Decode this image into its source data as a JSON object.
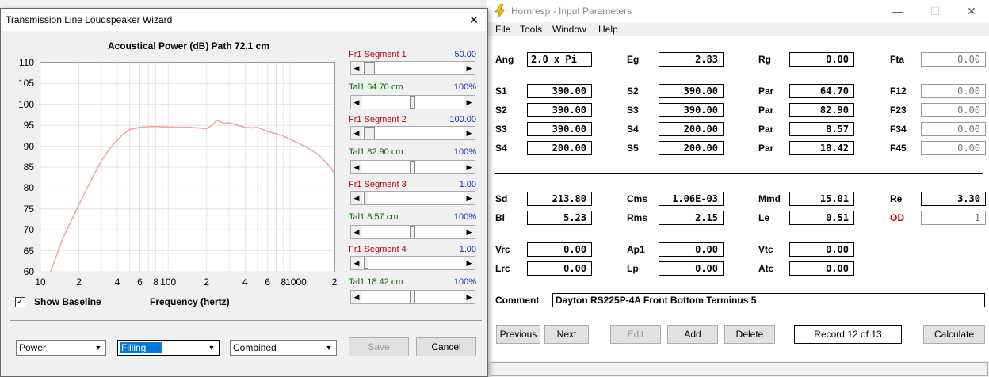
{
  "hornresp": {
    "title": "Hornresp - Input Parameters",
    "menu": [
      "File",
      "Tools",
      "Window",
      "Help"
    ],
    "params": {
      "Ang": "2.0 x Pi",
      "Eg": "2.83",
      "Rg": "0.00",
      "Fta": "0.00",
      "S1": "390.00",
      "S2a": "390.00",
      "Par1": "64.70",
      "F12": "0.00",
      "S2": "390.00",
      "S3a": "390.00",
      "Par2": "82.90",
      "F23": "0.00",
      "S3": "390.00",
      "S4a": "200.00",
      "Par3": "8.57",
      "F34": "0.00",
      "S4": "200.00",
      "S5": "200.00",
      "Par4": "18.42",
      "F45": "0.00",
      "Sd": "213.80",
      "Cms": "1.06E-03",
      "Mmd": "15.01",
      "Re": "3.30",
      "Bl": "5.23",
      "Rms": "2.15",
      "Le": "0.51",
      "OD": "1",
      "Vrc": "0.00",
      "Ap1": "0.00",
      "Vtc": "0.00",
      "Lrc": "0.00",
      "Lp": "0.00",
      "Atc": "0.00"
    },
    "labels": {
      "Ang": "Ang",
      "Eg": "Eg",
      "Rg": "Rg",
      "Fta": "Fta",
      "S1": "S1",
      "S2": "S2",
      "S3": "S3",
      "S4": "S4",
      "S5": "S5",
      "Par": "Par",
      "F12": "F12",
      "F23": "F23",
      "F34": "F34",
      "F45": "F45",
      "Sd": "Sd",
      "Cms": "Cms",
      "Mmd": "Mmd",
      "Re": "Re",
      "Bl": "Bl",
      "Rms": "Rms",
      "Le": "Le",
      "OD": "OD",
      "Vrc": "Vrc",
      "Ap1": "Ap1",
      "Vtc": "Vtc",
      "Lrc": "Lrc",
      "Lp": "Lp",
      "Atc": "Atc",
      "Comment": "Comment"
    },
    "comment": "Dayton RS225P-4A Front Bottom Terminus 5",
    "buttons": {
      "previous": "Previous",
      "next": "Next",
      "edit": "Edit",
      "add": "Add",
      "delete": "Delete",
      "record": "Record 12 of 13",
      "calculate": "Calculate"
    }
  },
  "wizard": {
    "title": "Transmission Line Loudspeaker Wizard",
    "chart_title": "Acoustical Power (dB)   Path 72.1 cm",
    "show_baseline": "Show Baseline",
    "xlabel": "Frequency (hertz)",
    "segments": [
      {
        "fr_label": "Fr1  Segment 1",
        "fr_value": "50.00",
        "tal_label": "Tal1  64.70 cm",
        "tal_value": "100%"
      },
      {
        "fr_label": "Fr1  Segment 2",
        "fr_value": "100.00",
        "tal_label": "Tal1  82.90 cm",
        "tal_value": "100%"
      },
      {
        "fr_label": "Fr1  Segment 3",
        "fr_value": "1.00",
        "tal_label": "Tal1  8.57 cm",
        "tal_value": "100%"
      },
      {
        "fr_label": "Fr1  Segment 4",
        "fr_value": "1.00",
        "tal_label": "Tal1  18.42 cm",
        "tal_value": "100%"
      }
    ],
    "combos": {
      "power": "Power",
      "filling": "Filling",
      "combined": "Combined"
    },
    "save": "Save",
    "cancel": "Cancel",
    "colors": {
      "curve": "#f4a6a0",
      "fr_label": "#c00000",
      "tal_label": "#007000",
      "fr_value": "#1030c0",
      "tal_value": "#1030c0",
      "od_label": "#e00000"
    }
  },
  "chart_data": {
    "type": "line",
    "title": "Acoustical Power (dB)   Path 72.1 cm",
    "xlabel": "Frequency (hertz)",
    "ylabel": "",
    "xscale": "log",
    "xlim": [
      10,
      2000
    ],
    "ylim": [
      60,
      110
    ],
    "yticks": [
      "110",
      "105",
      "100",
      "95",
      "90",
      "85",
      "80",
      "75",
      "70",
      "65",
      "60"
    ],
    "xticks": [
      "10",
      "2",
      "4",
      "6",
      "8",
      "100",
      "2",
      "4",
      "6",
      "8",
      "1000",
      "2"
    ],
    "grid": true,
    "series": [
      {
        "x": [
          12,
          15,
          20,
          25,
          30,
          35,
          40,
          45,
          50,
          60,
          70,
          80,
          100,
          150,
          200,
          220,
          240,
          260,
          280,
          300,
          350,
          400,
          450,
          500,
          550,
          600,
          700,
          800,
          1000,
          1200,
          1500,
          1800,
          2000
        ],
        "y": [
          60,
          68,
          76,
          82,
          86.5,
          89.5,
          91.5,
          93,
          94,
          94.5,
          94.7,
          94.7,
          94.6,
          94.5,
          94.2,
          95,
          96.2,
          95.8,
          95.5,
          95.6,
          95,
          94.5,
          94.4,
          94.5,
          94,
          93.5,
          93,
          92.4,
          91,
          89.8,
          88,
          85.5,
          83.5
        ]
      }
    ]
  }
}
